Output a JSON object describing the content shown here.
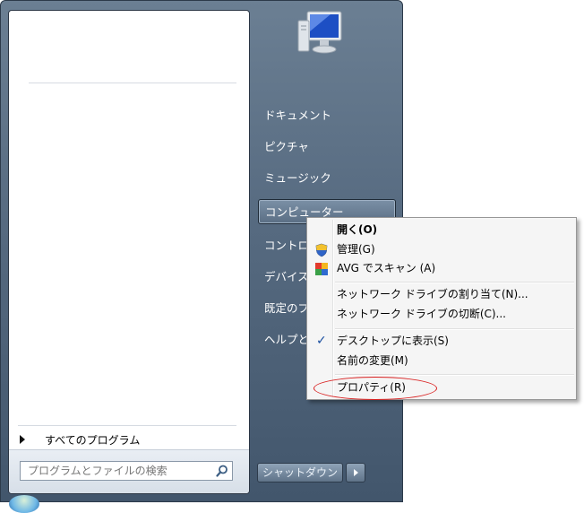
{
  "left_pane": {
    "all_programs_label": "すべてのプログラム",
    "search": {
      "placeholder": "プログラムとファイルの検索"
    }
  },
  "right_pane": {
    "items": [
      {
        "label": "ドキュメント"
      },
      {
        "label": "ピクチャ"
      },
      {
        "label": "ミュージック"
      },
      {
        "label": "コンピューター"
      },
      {
        "label": "コントロール パネル"
      },
      {
        "label": "デバイスとプリンター"
      },
      {
        "label": "既定のプログラム"
      },
      {
        "label": "ヘルプとサポート"
      }
    ],
    "shutdown_label": "シャットダウン"
  },
  "context_menu": {
    "items": [
      {
        "label": "開く(O)",
        "bold": true
      },
      {
        "label": "管理(G)",
        "icon": "shield-icon"
      },
      {
        "label": "AVG でスキャン (A)",
        "icon": "avg-icon"
      },
      {
        "label": "ネットワーク ドライブの割り当て(N)..."
      },
      {
        "label": "ネットワーク ドライブの切断(C)..."
      },
      {
        "label": "デスクトップに表示(S)",
        "checked": true
      },
      {
        "label": "名前の変更(M)"
      },
      {
        "label": "プロパティ(R)"
      }
    ]
  },
  "colors": {
    "highlight_ellipse": "#d92020",
    "checkmark": "#1a4fa0"
  }
}
